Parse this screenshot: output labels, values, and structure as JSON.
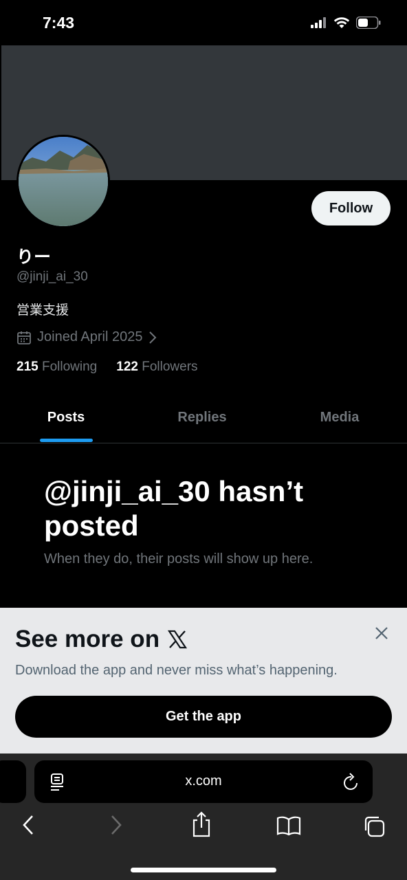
{
  "status_bar": {
    "time": "7:43"
  },
  "profile": {
    "display_name": "りー",
    "handle": "@jinji_ai_30",
    "bio": "営業支援",
    "joined": "Joined April 2025",
    "following_count": "215",
    "following_label": "Following",
    "followers_count": "122",
    "followers_label": "Followers",
    "follow_label": "Follow"
  },
  "tabs": [
    {
      "label": "Posts",
      "active": true
    },
    {
      "label": "Replies",
      "active": false
    },
    {
      "label": "Media",
      "active": false
    }
  ],
  "empty_state": {
    "title": "@jinji_ai_30 hasn’t posted",
    "subtitle": "When they do, their posts will show up here."
  },
  "promo": {
    "title": "See more on",
    "subtitle": "Download the app and never miss what’s happening.",
    "button": "Get the app"
  },
  "browser": {
    "url": "x.com"
  },
  "colors": {
    "accent": "#1d9bf0",
    "banner": "#33373b",
    "background": "#000000"
  }
}
